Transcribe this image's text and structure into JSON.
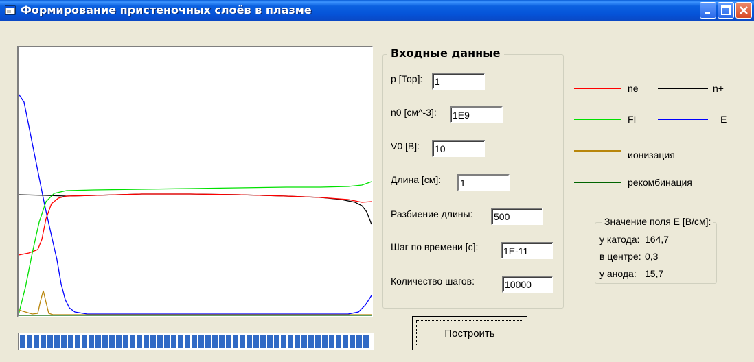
{
  "window": {
    "title": "Формирование пристеночных слоёв в плазме",
    "title_bar_color": "#0a54dc"
  },
  "inputs": {
    "group_title": "Входные данные",
    "pressure": {
      "label": "p [Тор]:",
      "value": "1"
    },
    "n0": {
      "label": "n0 [см^-3]:",
      "value": "1E9"
    },
    "v0": {
      "label": "V0 [В]:",
      "value": "10"
    },
    "length": {
      "label": "Длина [см]:",
      "value": "1"
    },
    "partition": {
      "label": "Разбиение длины:",
      "value": "500"
    },
    "timestep": {
      "label": "Шаг по времени [с]:",
      "value": "1E-11"
    },
    "steps": {
      "label": "Количество шагов:",
      "value": "10000"
    }
  },
  "build_button": "Построить",
  "legend": [
    {
      "name": "ne",
      "color": "#ff0000"
    },
    {
      "name": "n+",
      "color": "#000000"
    },
    {
      "name": "FI",
      "color": "#00e000"
    },
    {
      "name": "E",
      "color": "#0000ff"
    },
    {
      "name": "ионизация",
      "color": "#b8860b"
    },
    {
      "name": "рекомбинация",
      "color": "#006400"
    }
  ],
  "field": {
    "title": "Значение поля E [В/см]:",
    "cathode_label": "у катода:",
    "cathode_value": "164,7",
    "center_label": "в центре:",
    "center_value": "0,3",
    "anode_label": "у анода:",
    "anode_value": "15,7"
  },
  "progress": {
    "fraction": 1.0,
    "color": "#316ac5"
  }
}
